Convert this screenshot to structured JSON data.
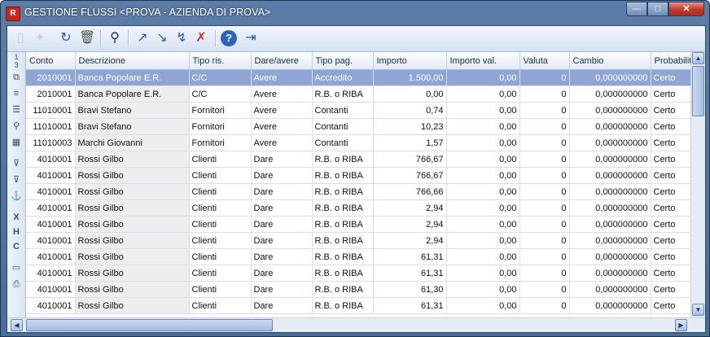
{
  "window": {
    "title": "GESTIONE FLUSSI <PROVA - AZIENDA DI PROVA>",
    "buttons": {
      "minimize": "—",
      "maximize": "□",
      "close": "✕"
    }
  },
  "toolbar": {
    "icons": [
      "new-icon",
      "delete-icon",
      "refresh-icon",
      "trash-icon",
      "search-binoculars-icon",
      "edit-arrow-icon",
      "edit-down-icon",
      "edit-check-icon",
      "edit-cancel-icon",
      "help-icon",
      "exit-icon"
    ]
  },
  "sidebar": {
    "row_counter": "1\n3",
    "icons": [
      "copy-icon",
      "list-icon",
      "list-detail-icon",
      "zoom-icon",
      "calculator-icon",
      "filter-icon",
      "filter-remove-icon",
      "anchor-icon",
      "excel-export-icon",
      "html-export-icon",
      "csv-export-icon",
      "screen-icon",
      "print-icon"
    ]
  },
  "grid": {
    "columns": [
      "Conto",
      "Descrizione",
      "Tipo ris.",
      "Dare/avere",
      "Tipo pag.",
      "Importo",
      "Importo val.",
      "Valuta",
      "Cambio",
      "Probabilità"
    ],
    "rows": [
      [
        "2010001",
        "Banca Popolare E.R.",
        "C/C",
        "Avere",
        "Accredito",
        "1.500,00",
        "0,00",
        "0",
        "0,000000000",
        "Certo"
      ],
      [
        "2010001",
        "Banca Popolare E.R.",
        "C/C",
        "Avere",
        "R.B. o RIBA",
        "0,00",
        "0,00",
        "0",
        "0,000000000",
        "Certo"
      ],
      [
        "11010001",
        "Bravi Stefano",
        "Fornitori",
        "Avere",
        "Contanti",
        "0,74",
        "0,00",
        "0",
        "0,000000000",
        "Certo"
      ],
      [
        "11010001",
        "Bravi Stefano",
        "Fornitori",
        "Avere",
        "Contanti",
        "10,23",
        "0,00",
        "0",
        "0,000000000",
        "Certo"
      ],
      [
        "11010003",
        "Marchi Giovanni",
        "Fornitori",
        "Avere",
        "Contanti",
        "1,57",
        "0,00",
        "0",
        "0,000000000",
        "Certo"
      ],
      [
        "4010001",
        "Rossi Gilbo",
        "Clienti",
        "Dare",
        "R.B. o RIBA",
        "766,67",
        "0,00",
        "0",
        "0,000000000",
        "Certo"
      ],
      [
        "4010001",
        "Rossi Gilbo",
        "Clienti",
        "Dare",
        "R.B. o RIBA",
        "766,67",
        "0,00",
        "0",
        "0,000000000",
        "Certo"
      ],
      [
        "4010001",
        "Rossi Gilbo",
        "Clienti",
        "Dare",
        "R.B. o RIBA",
        "766,66",
        "0,00",
        "0",
        "0,000000000",
        "Certo"
      ],
      [
        "4010001",
        "Rossi Gilbo",
        "Clienti",
        "Dare",
        "R.B. o RIBA",
        "2,94",
        "0,00",
        "0",
        "0,000000000",
        "Certo"
      ],
      [
        "4010001",
        "Rossi Gilbo",
        "Clienti",
        "Dare",
        "R.B. o RIBA",
        "2,94",
        "0,00",
        "0",
        "0,000000000",
        "Certo"
      ],
      [
        "4010001",
        "Rossi Gilbo",
        "Clienti",
        "Dare",
        "R.B. o RIBA",
        "2,94",
        "0,00",
        "0",
        "0,000000000",
        "Certo"
      ],
      [
        "4010001",
        "Rossi Gilbo",
        "Clienti",
        "Dare",
        "R.B. o RIBA",
        "61,31",
        "0,00",
        "0",
        "0,000000000",
        "Certo"
      ],
      [
        "4010001",
        "Rossi Gilbo",
        "Clienti",
        "Dare",
        "R.B. o RIBA",
        "61,31",
        "0,00",
        "0",
        "0,000000000",
        "Certo"
      ],
      [
        "4010001",
        "Rossi Gilbo",
        "Clienti",
        "Dare",
        "R.B. o RIBA",
        "61,30",
        "0,00",
        "0",
        "0,000000000",
        "Certo"
      ],
      [
        "4010001",
        "Rossi Gilbo",
        "Clienti",
        "Dare",
        "R.B. o RIBA",
        "61,31",
        "0,00",
        "0",
        "0,000000000",
        "Certo"
      ]
    ],
    "selected_row": 0
  },
  "colors": {
    "selection": "#8fa5d6",
    "titlebar": "#5b7da8"
  }
}
